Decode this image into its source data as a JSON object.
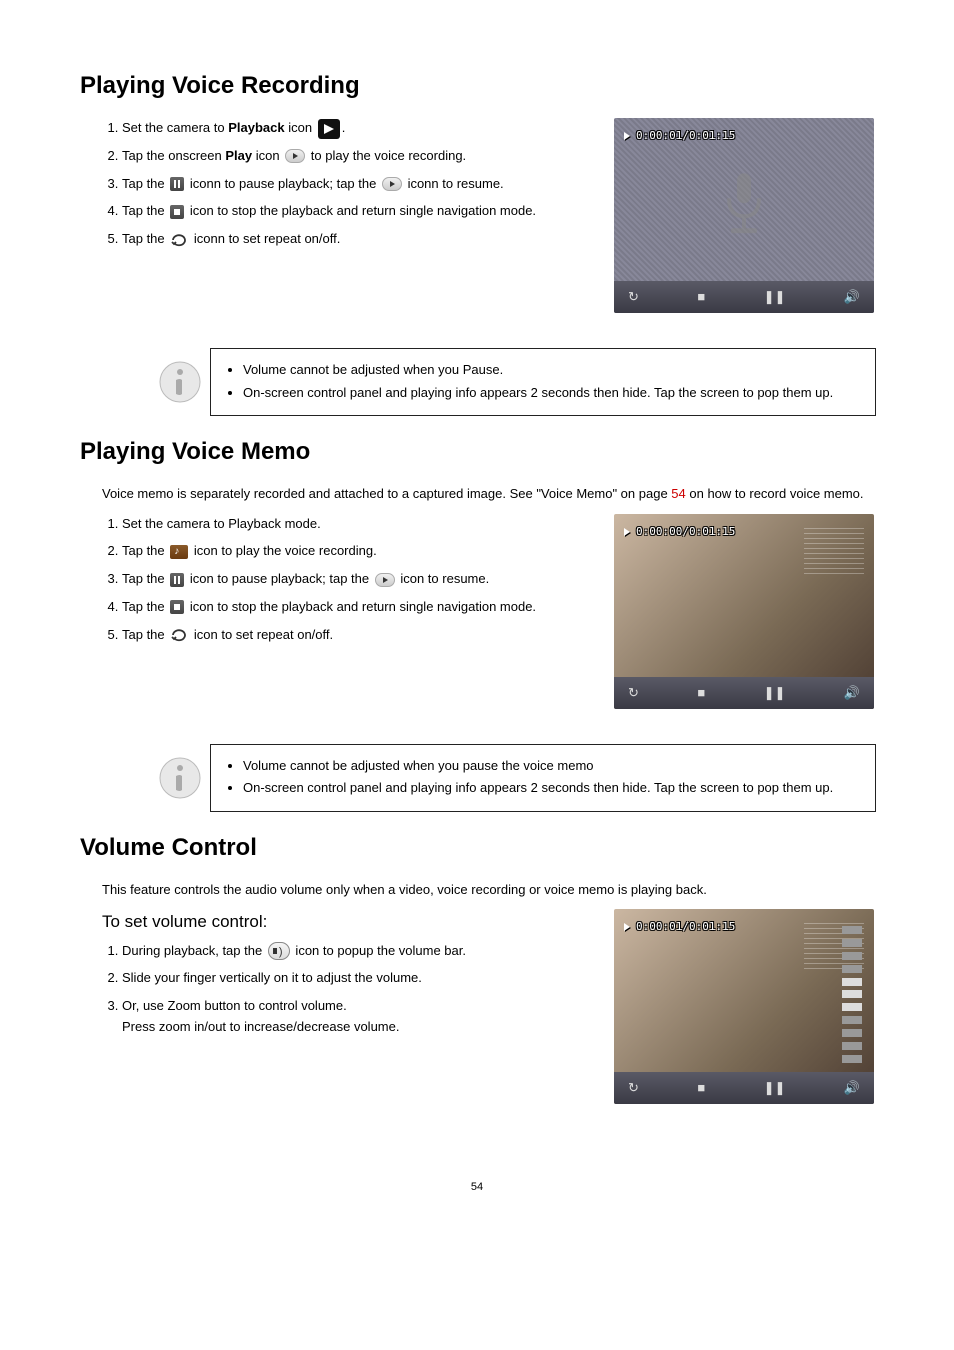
{
  "sections": {
    "voice_recording": {
      "heading": "Playing Voice Recording",
      "steps": {
        "s1a": "Set the camera to ",
        "s1b": "Playback",
        "s1c": " icon ",
        "s1d": ".",
        "s2a": "Tap the onscreen ",
        "s2b": "Play",
        "s2c": " icon ",
        "s2d": " to play the voice recording.",
        "s3a": "Tap the ",
        "s3b": " iconn to pause playback; tap the ",
        "s3c": " iconn to resume.",
        "s4a": "Tap the ",
        "s4b": " icon to stop the playback and return single navigation mode.",
        "s5a": "Tap the ",
        "s5b": " iconn to set repeat on/off."
      },
      "notes": {
        "n1": "Volume cannot be adjusted when you Pause.",
        "n2": "On-screen control panel and playing info appears 2 seconds then hide. Tap the screen to pop them up."
      },
      "screenshot_time": "0:00:01/0:01:15"
    },
    "voice_memo": {
      "heading": "Playing Voice Memo",
      "intro_a": "Voice memo is separately recorded and attached to a captured image. See \"Voice Memo\" on page ",
      "intro_link": "54",
      "intro_b": " on how to record voice memo.",
      "steps": {
        "s1": "Set the camera to Playback mode.",
        "s2a": "Tap the ",
        "s2b": " icon to play the voice recording.",
        "s3a": "Tap the ",
        "s3b": " icon to pause playback; tap the ",
        "s3c": " icon to resume.",
        "s4a": "Tap the ",
        "s4b": " icon to stop the playback and return single navigation mode.",
        "s5a": "Tap the ",
        "s5b": " icon to set repeat on/off."
      },
      "notes": {
        "n1": "Volume cannot be adjusted when you pause the voice memo",
        "n2": "On-screen control panel and playing info appears 2 seconds then hide. Tap the screen to pop them up."
      },
      "screenshot_time": "0:00:00/0:01:15"
    },
    "volume_control": {
      "heading": "Volume Control",
      "intro": "This feature controls the audio volume only when a video, voice recording or voice memo is playing back.",
      "subheading": "To set volume control:",
      "steps": {
        "s1a": "During playback, tap the ",
        "s1b": " icon to popup the volume bar.",
        "s2": "Slide your finger vertically on it to adjust the volume.",
        "s3": "Or, use Zoom button to control volume.\nPress zoom in/out to increase/decrease volume."
      },
      "screenshot_time": "0:00:01/0:01:15"
    }
  },
  "page_number": "54"
}
